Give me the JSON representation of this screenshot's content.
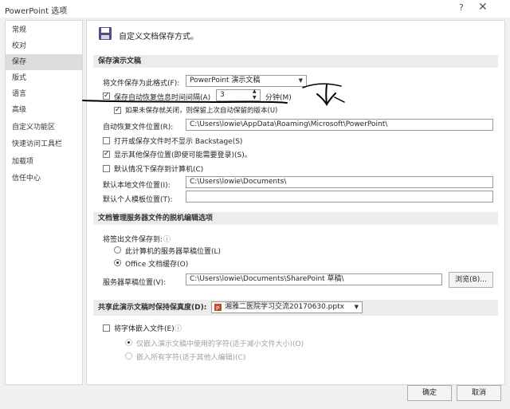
{
  "window": {
    "title": "PowerPoint 选项",
    "help_glyph": "?",
    "close_glyph": "✕"
  },
  "sidebar": {
    "items": [
      {
        "label": "常规"
      },
      {
        "label": "校对"
      },
      {
        "label": "保存",
        "active": true
      },
      {
        "label": "版式"
      },
      {
        "label": "语言"
      },
      {
        "label": "高级"
      },
      {
        "label": "自定义功能区"
      },
      {
        "label": "快速访问工具栏"
      },
      {
        "label": "加载项"
      },
      {
        "label": "信任中心"
      }
    ]
  },
  "header": {
    "icon": "floppy-disk-icon",
    "title": "自定义文档保存方式。"
  },
  "save_section": {
    "title": "保存演示文稿",
    "format_label": "将文件保存为此格式(F):",
    "format_value": "PowerPoint 演示文稿",
    "autorecover_label": "保存自动恢复信息时间间隔(A)",
    "autorecover_checked": true,
    "autorecover_minutes": "3",
    "minutes_label": "分钟(M)",
    "keep_last_label": "如果未保存就关闭，则保留上次自动保留的版本(U)",
    "keep_last_checked": true,
    "autorecover_location_label": "自动恢复文件位置(R):",
    "autorecover_location_value": "C:\\Users\\lowie\\AppData\\Roaming\\Microsoft\\PowerPoint\\",
    "no_backstage_label": "打开或保存文件时不显示 Backstage(S)",
    "no_backstage_checked": false,
    "show_other_label": "显示其他保存位置(即使可能需要登录)(S)。",
    "show_other_checked": true,
    "default_computer_label": "默认情况下保存到计算机(C)",
    "default_computer_checked": false,
    "default_local_label": "默认本地文件位置(I):",
    "default_local_value": "C:\\Users\\lowie\\Documents\\",
    "personal_templates_label": "默认个人模板位置(T):",
    "personal_templates_value": ""
  },
  "offline_section": {
    "title": "文档管理服务器文件的脱机编辑选项",
    "save_to_label": "将签出文件保存到:",
    "info_glyph": "ⓘ",
    "option_server_label": "此计算机的服务器草稿位置(L)",
    "option_server_selected": false,
    "option_cache_label": "Office 文档缓存(O)",
    "option_cache_selected": true,
    "drafts_label": "服务器草稿位置(V):",
    "drafts_value": "C:\\Users\\lowie\\Documents\\SharePoint 草稿\\",
    "browse_label": "浏览(B)..."
  },
  "fidelity_section": {
    "title": "共享此演示文稿时保持保真度(D):",
    "file_value": "湘雅二医院学习交流20170630.pptx",
    "embed_label": "将字体嵌入文件(E)",
    "embed_checked": false,
    "embed_used_label": "仅嵌入演示文稿中使用的字符(适于减小文件大小)(O)",
    "embed_all_label": "嵌入所有字符(适于其他人编辑)(C)"
  },
  "footer": {
    "ok_label": "确定",
    "cancel_label": "取消"
  },
  "colors": {
    "annotation_ink": "#000000",
    "accent_checked": "#222222"
  }
}
